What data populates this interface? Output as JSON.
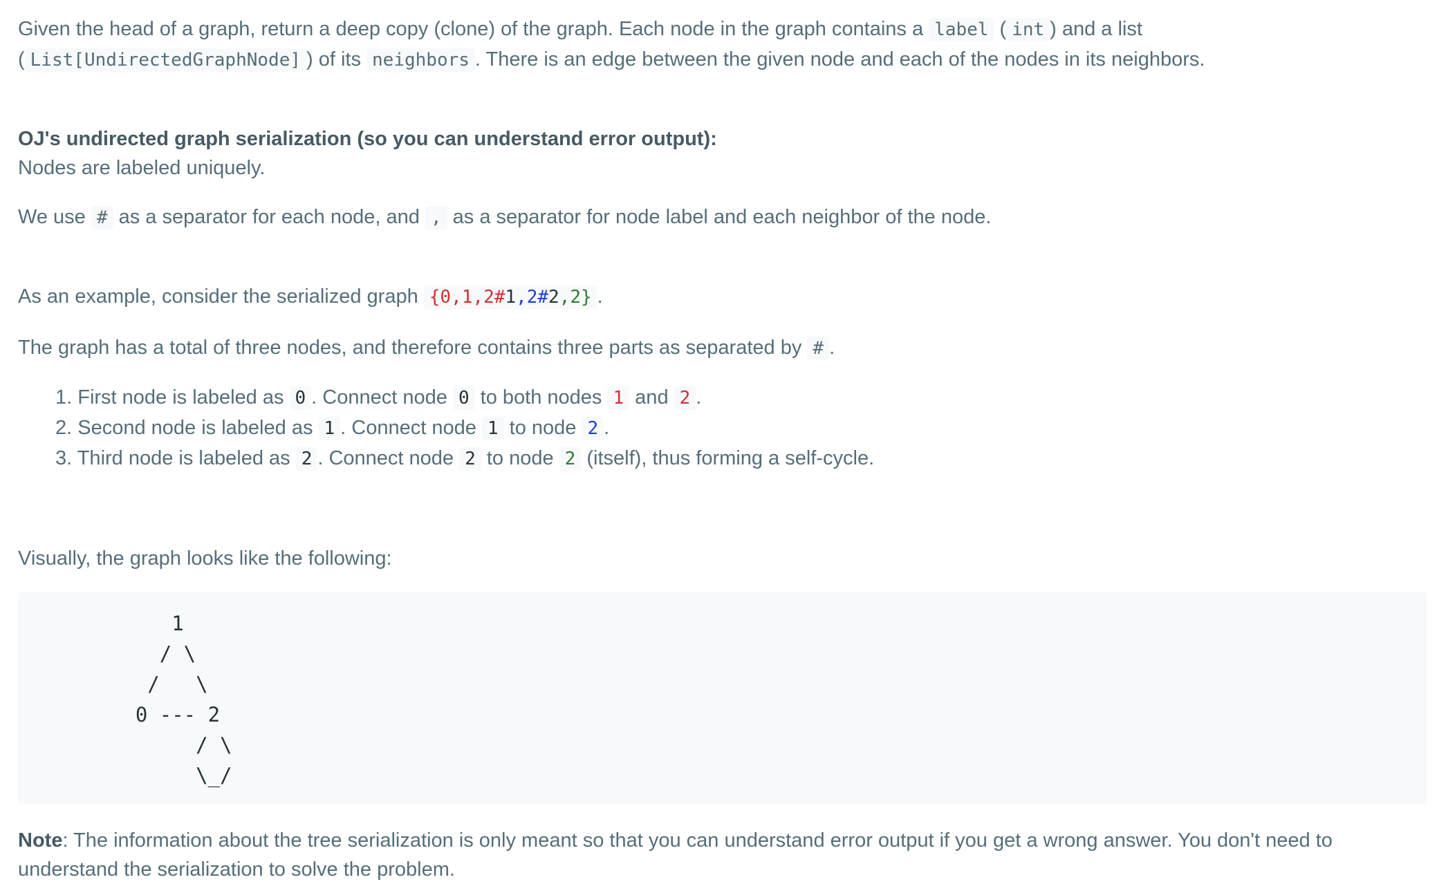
{
  "intro": {
    "t1": "Given the head of a graph, return a deep copy (clone) of the graph. Each node in the graph contains a ",
    "c_label": "label",
    "t2": " (",
    "c_int": "int",
    "t3": ") and a list",
    "t4": "(",
    "c_list": "List[UndirectedGraphNode]",
    "t5": ") of its ",
    "c_neighbors": "neighbors",
    "t6": ". There is an edge between the given node and each of the nodes in its neighbors."
  },
  "serialization": {
    "heading": "OJ's undirected graph serialization (so you can understand error output):",
    "unique": "Nodes are labeled uniquely.",
    "sep_t1": "We use ",
    "sep_hash": "#",
    "sep_t2": " as a separator for each node, and ",
    "sep_comma": ",",
    "sep_t3": " as a separator for node label and each neighbor of the node."
  },
  "example": {
    "t1": "As an example, consider the serialized graph ",
    "s_open": "{0,",
    "s_1": "1",
    "s_c1": ",",
    "s_2a": "2",
    "s_hash1": "#",
    "s_n1": "1",
    "s_c2": ",",
    "s_2b": "2",
    "s_hash2": "#",
    "s_n2": "2",
    "s_c3": ",",
    "s_2c": "2",
    "s_close": "}",
    "t2": ".",
    "total_t1": "The graph has a total of three nodes, and therefore contains three parts as separated by ",
    "total_hash": "#",
    "total_t2": "."
  },
  "steps": [
    {
      "num": "1.",
      "a": " First node is labeled as ",
      "c1": "0",
      "b": ". Connect node ",
      "c2": "0",
      "c": " to both nodes ",
      "c3": "1",
      "d": " and ",
      "c4": "2",
      "e": "."
    },
    {
      "num": "2.",
      "a": " Second node is labeled as ",
      "c1": "1",
      "b": ". Connect node ",
      "c2": "1",
      "c": " to node ",
      "c3": "2",
      "e": "."
    },
    {
      "num": "3.",
      "a": " Third node is labeled as ",
      "c1": "2",
      "b": ". Connect node ",
      "c2": "2",
      "c": " to node ",
      "c3": "2",
      "e": " (itself), thus forming a self-cycle."
    }
  ],
  "visual": {
    "intro": "Visually, the graph looks like the following:",
    "ascii": "       1\n      / \\\n     /   \\\n    0 --- 2\n         / \\\n         \\_/"
  },
  "note": {
    "label": "Note",
    "line1": ": The information about the tree serialization is only meant so that you can understand error output if you get a wrong answer. You don't need to",
    "line2": "understand the serialization to solve the problem."
  }
}
